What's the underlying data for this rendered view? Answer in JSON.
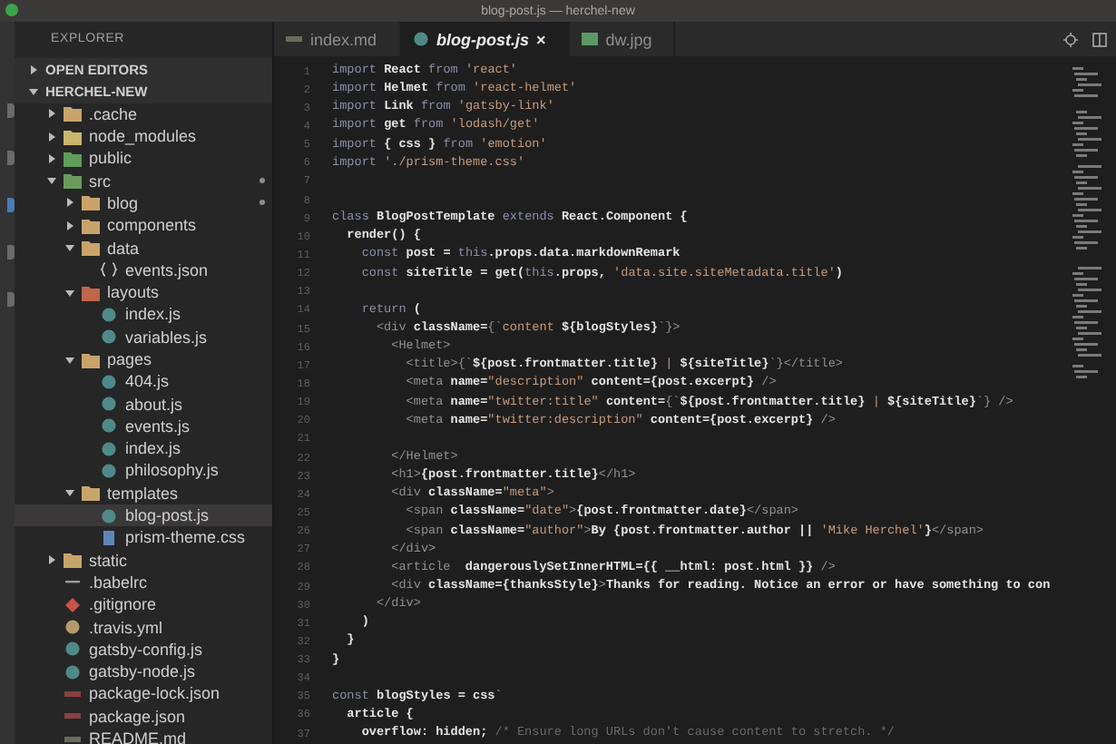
{
  "window": {
    "title": "blog-post.js — herchel-new"
  },
  "explorer": {
    "title": "EXPLORER",
    "sections": [
      {
        "label": "OPEN EDITORS",
        "expanded": false
      },
      {
        "label": "HERCHEL-NEW",
        "expanded": true,
        "items": [
          {
            "name": ".cache",
            "kind": "folder",
            "color": "#c9a46a",
            "expanded": false,
            "selected": false,
            "modified": false
          },
          {
            "name": "node_modules",
            "kind": "folder",
            "color": "#c8b66c",
            "expanded": false,
            "selected": false,
            "modified": false
          },
          {
            "name": "public",
            "kind": "folder",
            "color": "#5f9e5a",
            "expanded": false,
            "selected": false,
            "modified": false
          },
          {
            "name": "src",
            "kind": "folder",
            "color": "#6b9a5c",
            "expanded": true,
            "selected": false,
            "modified": true,
            "children": [
              {
                "name": "blog",
                "kind": "folder",
                "color": "#c9a46a",
                "expanded": false,
                "selected": false,
                "modified": true
              },
              {
                "name": "components",
                "kind": "folder",
                "color": "#c9a46a",
                "expanded": false,
                "selected": false,
                "modified": false
              },
              {
                "name": "data",
                "kind": "folder",
                "color": "#c9a46a",
                "expanded": true,
                "selected": false,
                "modified": false,
                "children": [
                  {
                    "name": "events.json",
                    "kind": "json",
                    "selected": false,
                    "modified": false
                  }
                ]
              },
              {
                "name": "layouts",
                "kind": "folder",
                "color": "#c0664a",
                "expanded": true,
                "selected": false,
                "modified": false,
                "children": [
                  {
                    "name": "index.js",
                    "kind": "js",
                    "selected": false,
                    "modified": false
                  },
                  {
                    "name": "variables.js",
                    "kind": "js",
                    "selected": false,
                    "modified": false
                  }
                ]
              },
              {
                "name": "pages",
                "kind": "folder",
                "color": "#c9a46a",
                "expanded": true,
                "selected": false,
                "modified": false,
                "children": [
                  {
                    "name": "404.js",
                    "kind": "js",
                    "selected": false,
                    "modified": false
                  },
                  {
                    "name": "about.js",
                    "kind": "js",
                    "selected": false,
                    "modified": false
                  },
                  {
                    "name": "events.js",
                    "kind": "js",
                    "selected": false,
                    "modified": false
                  },
                  {
                    "name": "index.js",
                    "kind": "js",
                    "selected": false,
                    "modified": false
                  },
                  {
                    "name": "philosophy.js",
                    "kind": "js",
                    "selected": false,
                    "modified": false
                  }
                ]
              },
              {
                "name": "templates",
                "kind": "folder",
                "color": "#c9a46a",
                "expanded": true,
                "selected": false,
                "modified": false,
                "children": [
                  {
                    "name": "blog-post.js",
                    "kind": "js",
                    "selected": true,
                    "modified": false
                  },
                  {
                    "name": "prism-theme.css",
                    "kind": "css",
                    "selected": false,
                    "modified": false
                  }
                ]
              }
            ]
          },
          {
            "name": "static",
            "kind": "folder",
            "color": "#c9a46a",
            "expanded": false,
            "selected": false,
            "modified": false
          },
          {
            "name": ".babelrc",
            "kind": "babelrc",
            "selected": false,
            "modified": false
          },
          {
            "name": ".gitignore",
            "kind": "git",
            "selected": false,
            "modified": false
          },
          {
            "name": ".travis.yml",
            "kind": "yml",
            "selected": false,
            "modified": false
          },
          {
            "name": "gatsby-config.js",
            "kind": "js",
            "selected": false,
            "modified": false
          },
          {
            "name": "gatsby-node.js",
            "kind": "js",
            "selected": false,
            "modified": false
          },
          {
            "name": "package-lock.json",
            "kind": "npm",
            "selected": false,
            "modified": false
          },
          {
            "name": "package.json",
            "kind": "npm",
            "selected": false,
            "modified": false
          },
          {
            "name": "README.md",
            "kind": "md",
            "selected": false,
            "modified": false
          }
        ]
      }
    ]
  },
  "tabs": [
    {
      "label": "index.md",
      "kind": "md",
      "selected": false
    },
    {
      "label": "blog-post.js",
      "kind": "js",
      "selected": true,
      "close": "×"
    },
    {
      "label": "dw.jpg",
      "kind": "image",
      "selected": false
    }
  ],
  "code": [
    {
      "number": "1",
      "tokens": [
        {
          "kind": "kw",
          "text": "import "
        },
        {
          "kind": "id",
          "text": "React"
        },
        {
          "kind": "kw",
          "text": " from "
        },
        {
          "kind": "str",
          "text": "'react'"
        }
      ]
    },
    {
      "number": "2",
      "tokens": [
        {
          "kind": "kw",
          "text": "import "
        },
        {
          "kind": "id",
          "text": "Helmet"
        },
        {
          "kind": "kw",
          "text": " from "
        },
        {
          "kind": "str",
          "text": "'react-helmet'"
        }
      ]
    },
    {
      "number": "3",
      "tokens": [
        {
          "kind": "kw",
          "text": "import "
        },
        {
          "kind": "id",
          "text": "Link"
        },
        {
          "kind": "kw",
          "text": " from "
        },
        {
          "kind": "str",
          "text": "'gatsby-link'"
        }
      ]
    },
    {
      "number": "4",
      "tokens": [
        {
          "kind": "kw",
          "text": "import "
        },
        {
          "kind": "id",
          "text": "get"
        },
        {
          "kind": "kw",
          "text": " from "
        },
        {
          "kind": "str",
          "text": "'lodash/get'"
        }
      ]
    },
    {
      "number": "5",
      "tokens": [
        {
          "kind": "kw",
          "text": "import "
        },
        {
          "kind": "id",
          "text": "{ css }"
        },
        {
          "kind": "kw",
          "text": " from "
        },
        {
          "kind": "str",
          "text": "'emotion'"
        }
      ]
    },
    {
      "number": "6",
      "tokens": [
        {
          "kind": "kw",
          "text": "import "
        },
        {
          "kind": "str",
          "text": "'./prism-theme.css'"
        }
      ]
    },
    {
      "number": "7"
    },
    {
      "number": "8"
    },
    {
      "number": "9",
      "tokens": [
        {
          "kind": "kw",
          "text": "class "
        },
        {
          "kind": "id",
          "text": "BlogPostTemplate"
        },
        {
          "kind": "kw",
          "text": " extends "
        },
        {
          "kind": "id",
          "text": "React.Component {"
        }
      ]
    },
    {
      "number": "10",
      "tokens": [
        {
          "kind": "id",
          "text": "  render() {"
        }
      ]
    },
    {
      "number": "11",
      "tokens": [
        {
          "kind": "kw",
          "text": "    const "
        },
        {
          "kind": "id",
          "text": "post = "
        },
        {
          "kind": "kw",
          "text": "this"
        },
        {
          "kind": "id",
          "text": ".props.data.markdownRemark"
        }
      ]
    },
    {
      "number": "12",
      "tokens": [
        {
          "kind": "kw",
          "text": "    const "
        },
        {
          "kind": "id",
          "text": "siteTitle = get("
        },
        {
          "kind": "kw",
          "text": "this"
        },
        {
          "kind": "id",
          "text": ".props, "
        },
        {
          "kind": "str",
          "text": "'data.site.siteMetadata.title'"
        },
        {
          "kind": "id",
          "text": ")"
        }
      ]
    },
    {
      "number": "13"
    },
    {
      "number": "14",
      "tokens": [
        {
          "kind": "kw",
          "text": "    return "
        },
        {
          "kind": "id",
          "text": "("
        }
      ]
    },
    {
      "number": "15",
      "tokens": [
        {
          "kind": "tag",
          "text": "      <div "
        },
        {
          "kind": "id",
          "text": "className="
        },
        {
          "kind": "tag",
          "text": "{`"
        },
        {
          "kind": "str",
          "text": "content "
        },
        {
          "kind": "id",
          "text": "${blogStyles}"
        },
        {
          "kind": "tag",
          "text": "`}>"
        }
      ]
    },
    {
      "number": "16",
      "tokens": [
        {
          "kind": "tag",
          "text": "        <Helmet>"
        }
      ]
    },
    {
      "number": "17",
      "tokens": [
        {
          "kind": "tag",
          "text": "          <title>{`"
        },
        {
          "kind": "id",
          "text": "${post.frontmatter.title}"
        },
        {
          "kind": "str",
          "text": " | "
        },
        {
          "kind": "id",
          "text": "${siteTitle}"
        },
        {
          "kind": "tag",
          "text": "`}</title>"
        }
      ]
    },
    {
      "number": "18",
      "tokens": [
        {
          "kind": "tag",
          "text": "          <meta "
        },
        {
          "kind": "id",
          "text": "name="
        },
        {
          "kind": "str",
          "text": "\"description\""
        },
        {
          "kind": "id",
          "text": " content={post.excerpt} "
        },
        {
          "kind": "tag",
          "text": "/>"
        }
      ]
    },
    {
      "number": "19",
      "tokens": [
        {
          "kind": "tag",
          "text": "          <meta "
        },
        {
          "kind": "id",
          "text": "name="
        },
        {
          "kind": "str",
          "text": "\"twitter:title\""
        },
        {
          "kind": "id",
          "text": " content="
        },
        {
          "kind": "tag",
          "text": "{`"
        },
        {
          "kind": "id",
          "text": "${post.frontmatter.title}"
        },
        {
          "kind": "str",
          "text": " | "
        },
        {
          "kind": "id",
          "text": "${siteTitle}"
        },
        {
          "kind": "tag",
          "text": "`} />"
        }
      ]
    },
    {
      "number": "20",
      "tokens": [
        {
          "kind": "tag",
          "text": "          <meta "
        },
        {
          "kind": "id",
          "text": "name="
        },
        {
          "kind": "str",
          "text": "\"twitter:description\""
        },
        {
          "kind": "id",
          "text": " content={post.excerpt} "
        },
        {
          "kind": "tag",
          "text": "/>"
        }
      ]
    },
    {
      "number": "21"
    },
    {
      "number": "22",
      "tokens": [
        {
          "kind": "tag",
          "text": "        </Helmet>"
        }
      ]
    },
    {
      "number": "23",
      "tokens": [
        {
          "kind": "tag",
          "text": "        <h1>"
        },
        {
          "kind": "id",
          "text": "{post.frontmatter.title}"
        },
        {
          "kind": "tag",
          "text": "</h1>"
        }
      ]
    },
    {
      "number": "24",
      "tokens": [
        {
          "kind": "tag",
          "text": "        <div "
        },
        {
          "kind": "id",
          "text": "className="
        },
        {
          "kind": "str",
          "text": "\"meta\""
        },
        {
          "kind": "tag",
          "text": ">"
        }
      ]
    },
    {
      "number": "25",
      "tokens": [
        {
          "kind": "tag",
          "text": "          <span "
        },
        {
          "kind": "id",
          "text": "className="
        },
        {
          "kind": "str",
          "text": "\"date\""
        },
        {
          "kind": "tag",
          "text": ">"
        },
        {
          "kind": "id",
          "text": "{post.frontmatter.date}"
        },
        {
          "kind": "tag",
          "text": "</span>"
        }
      ]
    },
    {
      "number": "26",
      "tokens": [
        {
          "kind": "tag",
          "text": "          <span "
        },
        {
          "kind": "id",
          "text": "className="
        },
        {
          "kind": "str",
          "text": "\"author\""
        },
        {
          "kind": "tag",
          "text": ">"
        },
        {
          "kind": "id",
          "text": "By {post.frontmatter.author || "
        },
        {
          "kind": "str",
          "text": "'Mike Herchel'"
        },
        {
          "kind": "id",
          "text": "}"
        },
        {
          "kind": "tag",
          "text": "</span>"
        }
      ]
    },
    {
      "number": "27",
      "tokens": [
        {
          "kind": "tag",
          "text": "        </div>"
        }
      ]
    },
    {
      "number": "28",
      "tokens": [
        {
          "kind": "tag",
          "text": "        <article  "
        },
        {
          "kind": "id",
          "text": "dangerouslySetInnerHTML={{ __html: post.html }} "
        },
        {
          "kind": "tag",
          "text": "/>"
        }
      ]
    },
    {
      "number": "29",
      "tokens": [
        {
          "kind": "tag",
          "text": "        <div "
        },
        {
          "kind": "id",
          "text": "className={thanksStyle}"
        },
        {
          "kind": "tag",
          "text": ">"
        },
        {
          "kind": "id",
          "text": "Thanks for reading. Notice an error or have something to con"
        }
      ]
    },
    {
      "number": "30",
      "tokens": [
        {
          "kind": "tag",
          "text": "      </div>"
        }
      ]
    },
    {
      "number": "31",
      "tokens": [
        {
          "kind": "id",
          "text": "    )"
        }
      ]
    },
    {
      "number": "32",
      "tokens": [
        {
          "kind": "id",
          "text": "  }"
        }
      ]
    },
    {
      "number": "33",
      "tokens": [
        {
          "kind": "id",
          "text": "}"
        }
      ]
    },
    {
      "number": "34"
    },
    {
      "number": "35",
      "tokens": [
        {
          "kind": "kw",
          "text": "const "
        },
        {
          "kind": "id",
          "text": "blogStyles = css"
        },
        {
          "kind": "str",
          "text": "`"
        }
      ]
    },
    {
      "number": "36",
      "tokens": [
        {
          "kind": "id",
          "text": "  article {"
        }
      ]
    },
    {
      "number": "37",
      "tokens": [
        {
          "kind": "id",
          "text": "    overflow: hidden; "
        },
        {
          "kind": "com",
          "text": "/* Ensure long URLs don't cause content to stretch. */"
        }
      ]
    }
  ]
}
